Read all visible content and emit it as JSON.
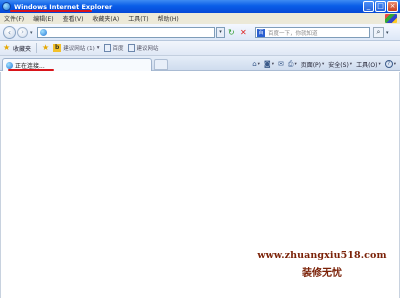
{
  "window": {
    "title": "Windows Internet Explorer",
    "controls": {
      "minimize": "_",
      "maximize": "□",
      "close": "×"
    }
  },
  "menubar": {
    "items": [
      "文件(F)",
      "编辑(E)",
      "查看(V)",
      "收藏夹(A)",
      "工具(T)",
      "帮助(H)"
    ]
  },
  "addressbar": {
    "value": "",
    "search_placeholder": "百度一下，你就知道",
    "search_logo": "百"
  },
  "favorites": {
    "label": "收藏夹",
    "items": [
      {
        "icon": "b-icon",
        "label": "建议网站 (1)",
        "dropdown": "▾"
      },
      {
        "icon": "page-icon",
        "label": "百度"
      },
      {
        "icon": "page-icon",
        "label": "建议网站"
      }
    ]
  },
  "tab": {
    "label": "正在连接..."
  },
  "commandbar": {
    "items": [
      {
        "icon": "home-icon",
        "glyph": "⌂"
      },
      {
        "icon": "feeds-icon",
        "glyph": "◙"
      },
      {
        "icon": "mail-icon",
        "glyph": "✉"
      },
      {
        "icon": "print-icon",
        "glyph": "⎙"
      },
      {
        "icon": "page-icon",
        "label": "页面(P)"
      },
      {
        "icon": "safety-icon",
        "label": "安全(S)"
      },
      {
        "icon": "tools-icon",
        "label": "工具(O)"
      },
      {
        "icon": "help-icon",
        "glyph": "?"
      }
    ]
  },
  "watermark": {
    "url": "www.zhuangxiu518.com",
    "text": "装修无忧"
  },
  "colors": {
    "titlebar": "#0a5ee8",
    "underline": "#d8141a",
    "watermark": "#7b2208"
  }
}
